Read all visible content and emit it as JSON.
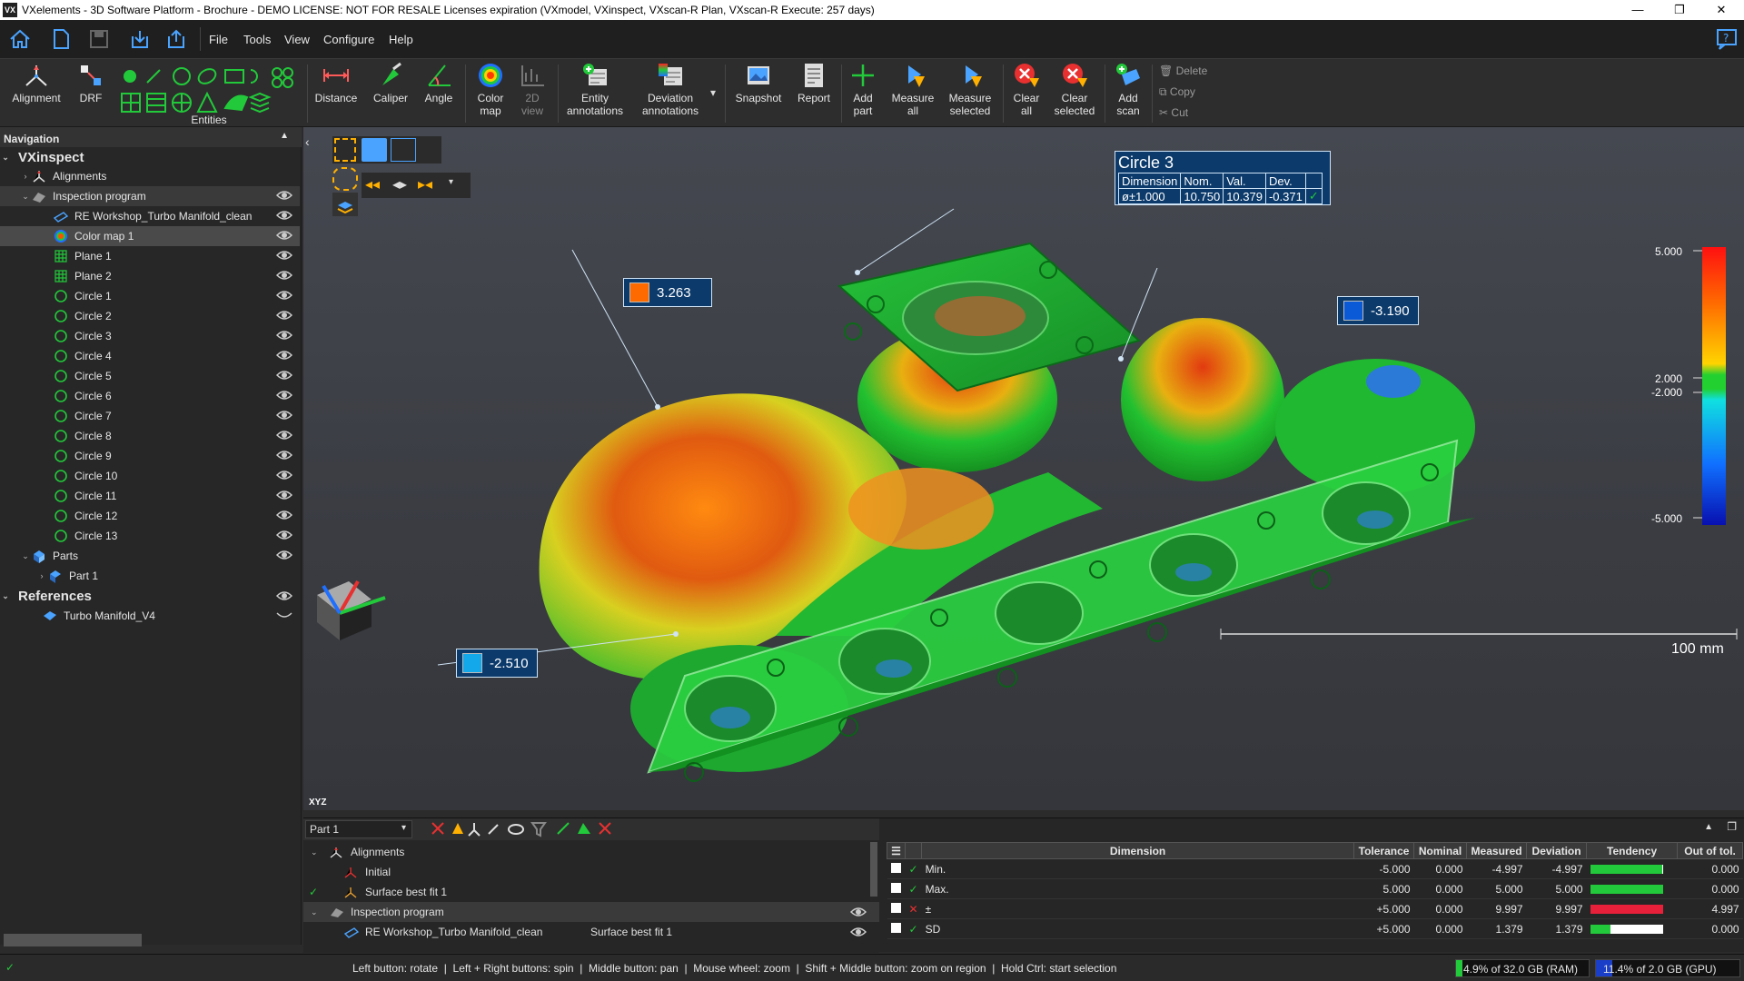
{
  "window": {
    "logo": "VX",
    "title": "VXelements - 3D Software Platform - Brochure - DEMO LICENSE: NOT FOR RESALE Licenses expiration (VXmodel, VXinspect, VXscan-R Plan, VXscan-R Execute: 257 days)",
    "controls": [
      "—",
      "❐",
      "✕"
    ]
  },
  "menu": {
    "items": [
      "File",
      "Tools",
      "View",
      "Configure",
      "Help"
    ]
  },
  "ribbon": {
    "alignment": "Alignment",
    "drf": "DRF",
    "entities": "Entities",
    "distance": "Distance",
    "caliper": "Caliper",
    "angle": "Angle",
    "color_map": [
      "Color",
      "map"
    ],
    "view_2d": [
      "2D",
      "view"
    ],
    "entity_annotations": [
      "Entity",
      "annotations"
    ],
    "deviation_annotations": [
      "Deviation",
      "annotations"
    ],
    "snapshot": "Snapshot",
    "report": "Report",
    "add_part": [
      "Add",
      "part"
    ],
    "measure_all": [
      "Measure",
      "all"
    ],
    "measure_selected": [
      "Measure",
      "selected"
    ],
    "clear_all": [
      "Clear",
      "all"
    ],
    "clear_selected": [
      "Clear",
      "selected"
    ],
    "add_scan": [
      "Add",
      "scan"
    ],
    "delete": "Delete",
    "copy": "Copy",
    "cut": "Cut"
  },
  "navigation": {
    "header": "Navigation",
    "vxinspect": "VXinspect",
    "alignments": "Alignments",
    "inspection_program": "Inspection program",
    "re_workshop": "RE Workshop_Turbo Manifold_clean",
    "color_map": "Color map 1",
    "planes": [
      "Plane 1",
      "Plane 2"
    ],
    "circles": [
      "Circle 1",
      "Circle 2",
      "Circle 3",
      "Circle 4",
      "Circle 5",
      "Circle 6",
      "Circle 7",
      "Circle 8",
      "Circle 9",
      "Circle 10",
      "Circle 11",
      "Circle 12",
      "Circle 13"
    ],
    "parts": "Parts",
    "part1": "Part 1",
    "references": "References",
    "turbo": "Turbo Manifold_V4"
  },
  "viewport": {
    "callouts": [
      {
        "value": "3.263",
        "color": "#ff6a00"
      },
      {
        "value": "-3.190",
        "color": "#0a5ad8"
      },
      {
        "value": "-2.510",
        "color": "#12a8ea"
      }
    ],
    "circle3": {
      "title": "Circle 3",
      "headers": [
        "Dimension",
        "Nom.",
        "Val.",
        "Dev."
      ],
      "row": [
        "ø±1.000",
        "10.750",
        "10.379",
        "-0.371"
      ],
      "status": "✓"
    },
    "colorscale": {
      "labels": [
        "5.000",
        "2.000",
        "-2.000",
        "-5.000"
      ]
    },
    "scale_bar": "100 mm",
    "axes": "XYZ"
  },
  "bottom_left": {
    "part_select": "Part 1",
    "rows": [
      {
        "label": "Alignments"
      },
      {
        "label": "Initial"
      },
      {
        "label": "Surface best fit 1"
      },
      {
        "label": "Inspection program"
      },
      {
        "label": "RE Workshop_Turbo Manifold_clean",
        "ref": "Surface best fit 1"
      }
    ]
  },
  "results": {
    "headers": [
      "Dimension",
      "Tolerance",
      "Nominal",
      "Measured",
      "Deviation",
      "Tendency",
      "Out of tol."
    ],
    "rows": [
      {
        "name": "Min.",
        "status": "✓",
        "tol": "-5.000",
        "nom": "0.000",
        "meas": "-4.997",
        "dev": "-4.997",
        "tend": 0.99,
        "tend_color": "#22c93a",
        "out": "0.000"
      },
      {
        "name": "Max.",
        "status": "✓",
        "tol": "5.000",
        "nom": "0.000",
        "meas": "5.000",
        "dev": "5.000",
        "tend": 1.0,
        "tend_color": "#22c93a",
        "out": "0.000"
      },
      {
        "name": "±",
        "status": "✕",
        "tol": "+5.000",
        "nom": "0.000",
        "meas": "9.997",
        "dev": "9.997",
        "tend": 1.0,
        "tend_color": "#e8203a",
        "out": "4.997"
      },
      {
        "name": "SD",
        "status": "✓",
        "tol": "+5.000",
        "nom": "0.000",
        "meas": "1.379",
        "dev": "1.379",
        "tend": 0.28,
        "tend_color": "#22c93a",
        "out": "0.000"
      }
    ]
  },
  "status": {
    "hint": "Left button: rotate  |  Left + Right buttons: spin  |  Middle button: pan  |  Mouse wheel: zoom  |  Shift + Middle button: zoom on region  |  Hold Ctrl: start selection",
    "ram": "4.9% of 32.0 GB (RAM)",
    "ram_fraction": 0.049,
    "gpu": "11.4% of 2.0 GB (GPU)",
    "gpu_fraction": 0.114
  }
}
